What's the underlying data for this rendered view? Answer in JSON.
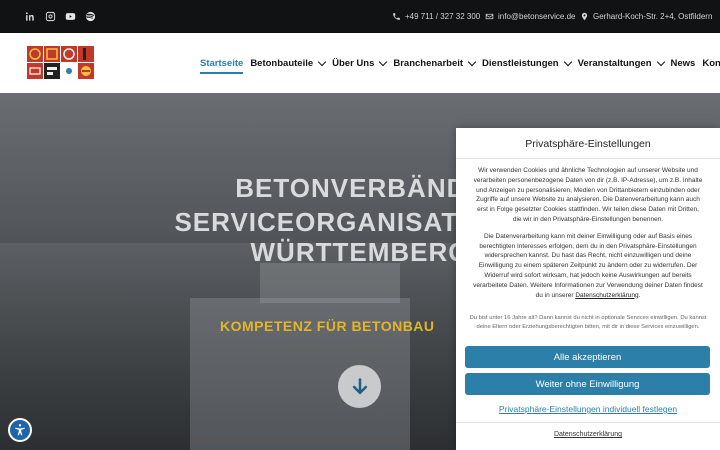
{
  "topbar": {
    "social": [
      {
        "icon": "linkedin-icon"
      },
      {
        "icon": "instagram-icon"
      },
      {
        "icon": "youtube-icon"
      },
      {
        "icon": "spotify-icon"
      }
    ],
    "phone": "+49 711 / 327 32 300",
    "email": "info@betonservice.de",
    "address": "Gerhard-Koch-Str. 2+4, Ostfildern"
  },
  "nav": {
    "items": [
      {
        "label": "Startseite",
        "active": true,
        "dropdown": false
      },
      {
        "label": "Betonbauteile",
        "active": false,
        "dropdown": true
      },
      {
        "label": "Über Uns",
        "active": false,
        "dropdown": true
      },
      {
        "label": "Branchenarbeit",
        "active": false,
        "dropdown": true
      },
      {
        "label": "Dienstleistungen",
        "active": false,
        "dropdown": true
      },
      {
        "label": "Veranstaltungen",
        "active": false,
        "dropdown": true
      },
      {
        "label": "News",
        "active": false,
        "dropdown": false
      },
      {
        "label": "Kontakt",
        "active": false,
        "dropdown": true
      }
    ]
  },
  "hero": {
    "line1": "BETONVERBÄNDE",
    "line2": "SERVICEORGANISATIONEN",
    "line3": "WÜRTTEMBERG",
    "subtitle": "KOMPETENZ FÜR BETONBAU"
  },
  "consent": {
    "title": "Privatsphäre-Einstellungen",
    "paragraph1": "Wir verwenden Cookies und ähnliche Technologien auf unserer Website und verarbeiten personenbezogene Daten von dir (z.B. IP-Adresse), um z.B. Inhalte und Anzeigen zu personalisieren, Medien von Drittanbietern einzubinden oder Zugriffe auf unsere Website zu analysieren. Die Datenverarbeitung kann auch erst in Folge gesetzter Cookies stattfinden. Wir teilen diese Daten mit Dritten, die wir in den Privatsphäre-Einstellungen benennen.",
    "paragraph2": "Die Datenverarbeitung kann mit deiner Einwilligung oder auf Basis eines berechtigten Interesses erfolgen, dem du in den Privatsphäre-Einstellungen widersprechen kannst. Du hast das Recht, nicht einzuwilligen und deine Einwilligung zu einem späteren Zeitpunkt zu ändern oder zu widerrufen. Der Widerruf wird sofort wirksam, hat jedoch keine Auswirkungen auf bereits verarbeitete Daten. Weitere Informationen zur Verwendung deiner Daten findest du in unserer",
    "paragraph2_link": "Datenschutzerklärung",
    "paragraph2_end": ".",
    "note": "Du bist unter 16 Jahre alt? Dann kannst du nicht in optionale Services einwilligen. Du kannst deine Eltern oder Erziehungsberechtigten bitten, mit dir in diese Services einzuwilligen.",
    "accept_all": "Alle akzeptieren",
    "continue_without": "Weiter ohne Einwilligung",
    "individual": "Privatsphäre-Einstellungen individuell festlegen",
    "privacy_link": "Datenschutzerklärung"
  },
  "colors": {
    "accent": "#2b7fa8",
    "hero_subtitle": "#e2b52a",
    "topbar": "#101214"
  }
}
